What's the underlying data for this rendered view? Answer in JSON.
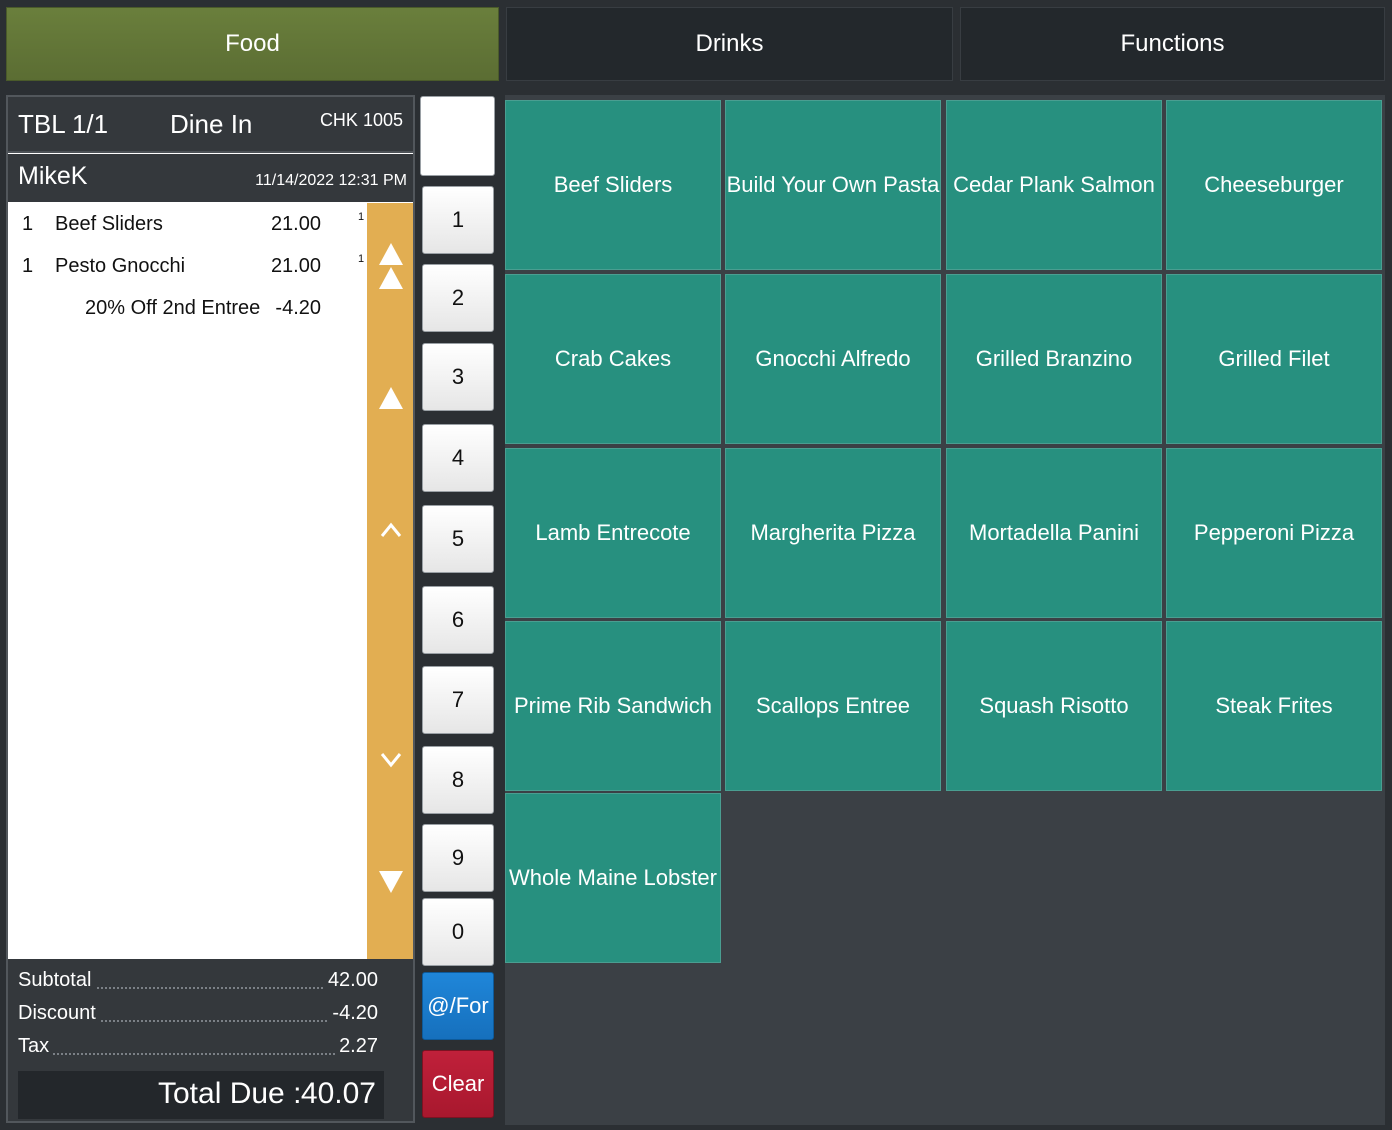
{
  "tabs": {
    "food": "Food",
    "drinks": "Drinks",
    "functions": "Functions"
  },
  "ticket": {
    "table": "TBL 1/1",
    "order_type": "Dine In",
    "check": "CHK 1005",
    "server": "MikeK",
    "timestamp": "11/14/2022 12:31 PM",
    "items": [
      {
        "qty": "1",
        "name": "Beef Sliders",
        "price": "21.00",
        "seat": "1"
      },
      {
        "qty": "1",
        "name": "Pesto Gnocchi",
        "price": "21.00",
        "seat": "1"
      }
    ],
    "modifier": {
      "name": "20% Off 2nd Entree",
      "price": "-4.20"
    },
    "subtotal_label": "Subtotal",
    "subtotal": "42.00",
    "discount_label": "Discount",
    "discount": "-4.20",
    "tax_label": "Tax",
    "tax": "2.27",
    "total_label": "Total Due :",
    "total": "40.07"
  },
  "keypad": {
    "keys": [
      "1",
      "2",
      "3",
      "4",
      "5",
      "6",
      "7",
      "8",
      "9",
      "0"
    ],
    "at_for": "@/For",
    "clear": "Clear"
  },
  "menu_items": [
    "Beef Sliders",
    "Build Your Own Pasta",
    "Cedar Plank Salmon",
    "Cheeseburger",
    "Crab Cakes",
    "Gnocchi Alfredo",
    "Grilled Branzino",
    "Grilled Filet",
    "Lamb Entrecote",
    "Margherita Pizza",
    "Mortadella Panini",
    "Pepperoni Pizza",
    "Prime Rib Sandwich",
    "Scallops Entree",
    "Squash Risotto",
    "Steak Frites",
    "Whole Maine Lobster"
  ],
  "colors": {
    "food_tab": "#5b6d33",
    "menu_button": "#27907f",
    "scrollbar": "#e2ae52",
    "at_for": "#1670bd",
    "clear": "#a8182e"
  }
}
